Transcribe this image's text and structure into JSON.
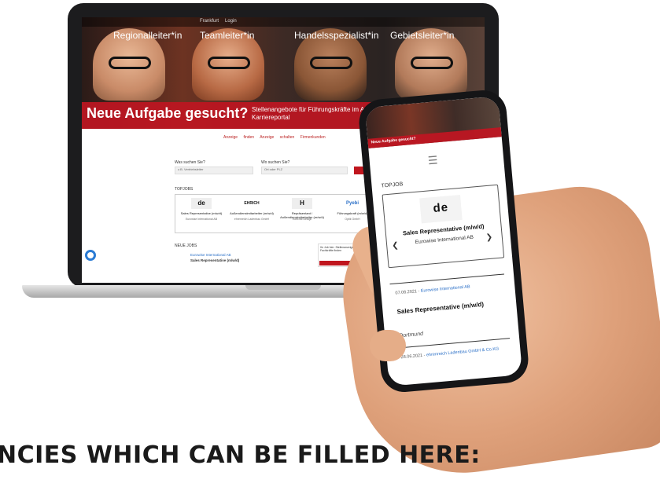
{
  "laptop": {
    "topnav": [
      "Frankfurt",
      "Login"
    ],
    "hero": {
      "roles": [
        "Regionalleiter*in",
        "Teamleiter*in",
        "Handelsspezialist*in",
        "Gebietsleiter*in"
      ],
      "headline": "Neue Aufgabe gesucht?",
      "subline": "Stellenangebote für Führungskräfte im Außendienst finden Sie im eyebizz Karriereportal"
    },
    "links": [
      "Anzeige finden",
      "Anzeige schalten",
      "Firmenkunden"
    ],
    "search": {
      "what_label": "Was suchen Sie?",
      "what_value": "z.B. Vertriebsleiter",
      "where_label": "Wo suchen Sie?",
      "where_value": "Ort oder PLZ"
    },
    "top_jobs_label": "TOPJOBS",
    "cards": [
      {
        "logo": "de",
        "title": "Sales Representative (m/w/d)",
        "company": "Eurowise International AB"
      },
      {
        "logo": "EHRICH",
        "title": "Außendienstmitarbeiter (m/w/d)",
        "company": "ehrenreich Ladenbau GmbH"
      },
      {
        "logo": "H",
        "title": "Repräsentant / Außendienstmitarbeiter (m/w/d)",
        "company": "Hoechst Design"
      },
      {
        "logo": "Pyebi",
        "title": "Führungskraft (m/w/d)",
        "company": "Optik GmbH"
      }
    ],
    "latest_label": "NEUE JOBS",
    "latest_item_company": "Eurowise International AB",
    "latest_item_title": "Sales Representative (m/w/d)",
    "sidebox_text": "Ihr Job hier: Stellenanzeige aufgeben und Fachkräfte finden"
  },
  "phone": {
    "hero_text": "Neue Aufgabe gesucht?",
    "menu_icon": "hamburger-icon",
    "section_label": "TOPJOB",
    "card": {
      "logo": "de",
      "title": "Sales Representative (m/w/d)",
      "company": "Eurowise International AB"
    },
    "listings": [
      {
        "date": "07.06.2021 - ",
        "company": "Eurowise International AB",
        "title": "Sales Representative (m/w/d)",
        "location": "Dortmund"
      },
      {
        "date": "28.06.2021 - ",
        "company": "ehrenreich Ladenbau GmbH & Co.KG",
        "title": "",
        "location": ""
      }
    ]
  },
  "caption": "NCIES WHICH CAN BE FILLED HERE:"
}
